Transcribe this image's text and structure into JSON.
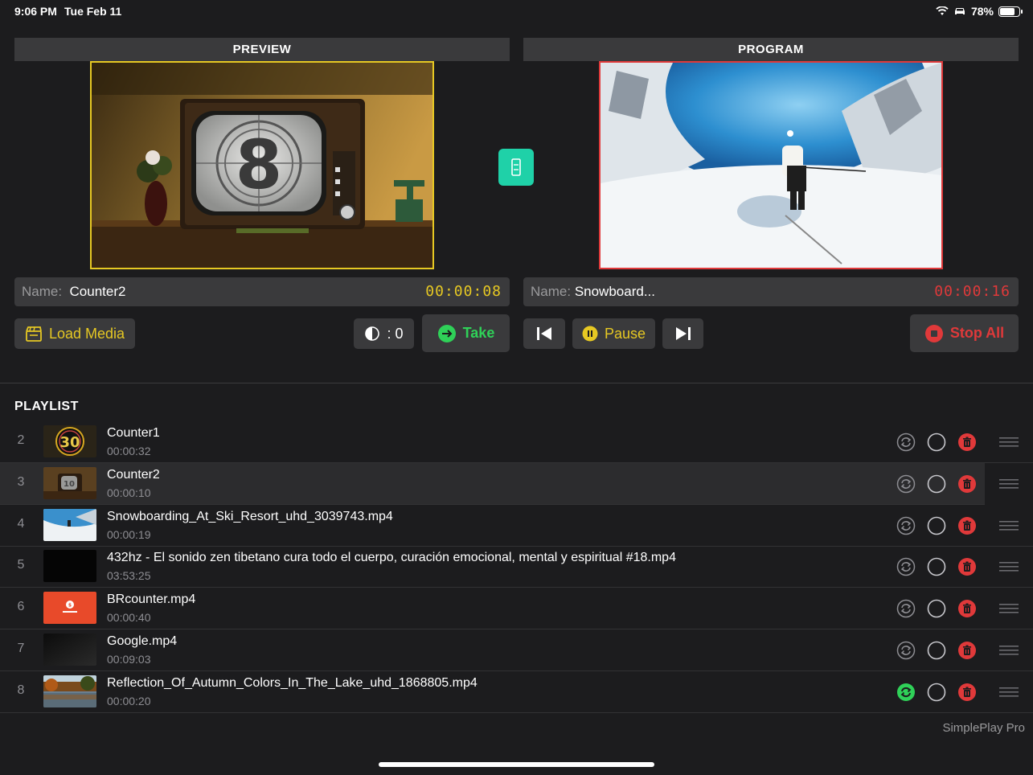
{
  "status": {
    "time": "9:06 PM",
    "date": "Tue Feb 11",
    "battery": "78%",
    "battery_level": 0.78
  },
  "preview": {
    "header": "PREVIEW",
    "name_label": "Name:",
    "name": "Counter2",
    "timecode": "00:00:08",
    "timecode_color": "#e6c823",
    "border_color": "#e6c823"
  },
  "program": {
    "header": "PROGRAM",
    "name_label": "Name:",
    "name": "Snowboard...",
    "timecode": "00:00:16",
    "timecode_color": "#e0393a",
    "border_color": "#e0393a"
  },
  "controls": {
    "load_media": "Load Media",
    "transition": ": 0",
    "take": "Take",
    "pause": "Pause",
    "stop_all": "Stop All",
    "accent_yellow": "#e6c823",
    "accent_green": "#2fd158",
    "accent_red": "#e0393a",
    "accent_teal": "#1fd1a8"
  },
  "playlist": {
    "title": "PLAYLIST",
    "items": [
      {
        "num": "2",
        "title": "Counter1",
        "duration": "00:00:32",
        "thumb": "counter30",
        "loop_active": false
      },
      {
        "num": "3",
        "title": "Counter2",
        "duration": "00:00:10",
        "thumb": "counter10",
        "loop_active": false,
        "active": true
      },
      {
        "num": "4",
        "title": "Snowboarding_At_Ski_Resort_uhd_3039743.mp4",
        "duration": "00:00:19",
        "thumb": "snow",
        "loop_active": false
      },
      {
        "num": "5",
        "title": "432hz - El sonido zen tibetano cura todo el cuerpo, curación emocional, mental y espiritual #18.mp4",
        "duration": "03:53:25",
        "thumb": "black",
        "loop_active": false
      },
      {
        "num": "6",
        "title": "BRcounter.mp4",
        "duration": "00:00:40",
        "thumb": "brcounter",
        "loop_active": false
      },
      {
        "num": "7",
        "title": "Google.mp4",
        "duration": "00:09:03",
        "thumb": "dark",
        "loop_active": false
      },
      {
        "num": "8",
        "title": "Reflection_Of_Autumn_Colors_In_The_Lake_uhd_1868805.mp4",
        "duration": "00:00:20",
        "thumb": "lake",
        "loop_active": true
      }
    ]
  },
  "footer": {
    "brand": "SimplePlay Pro"
  }
}
